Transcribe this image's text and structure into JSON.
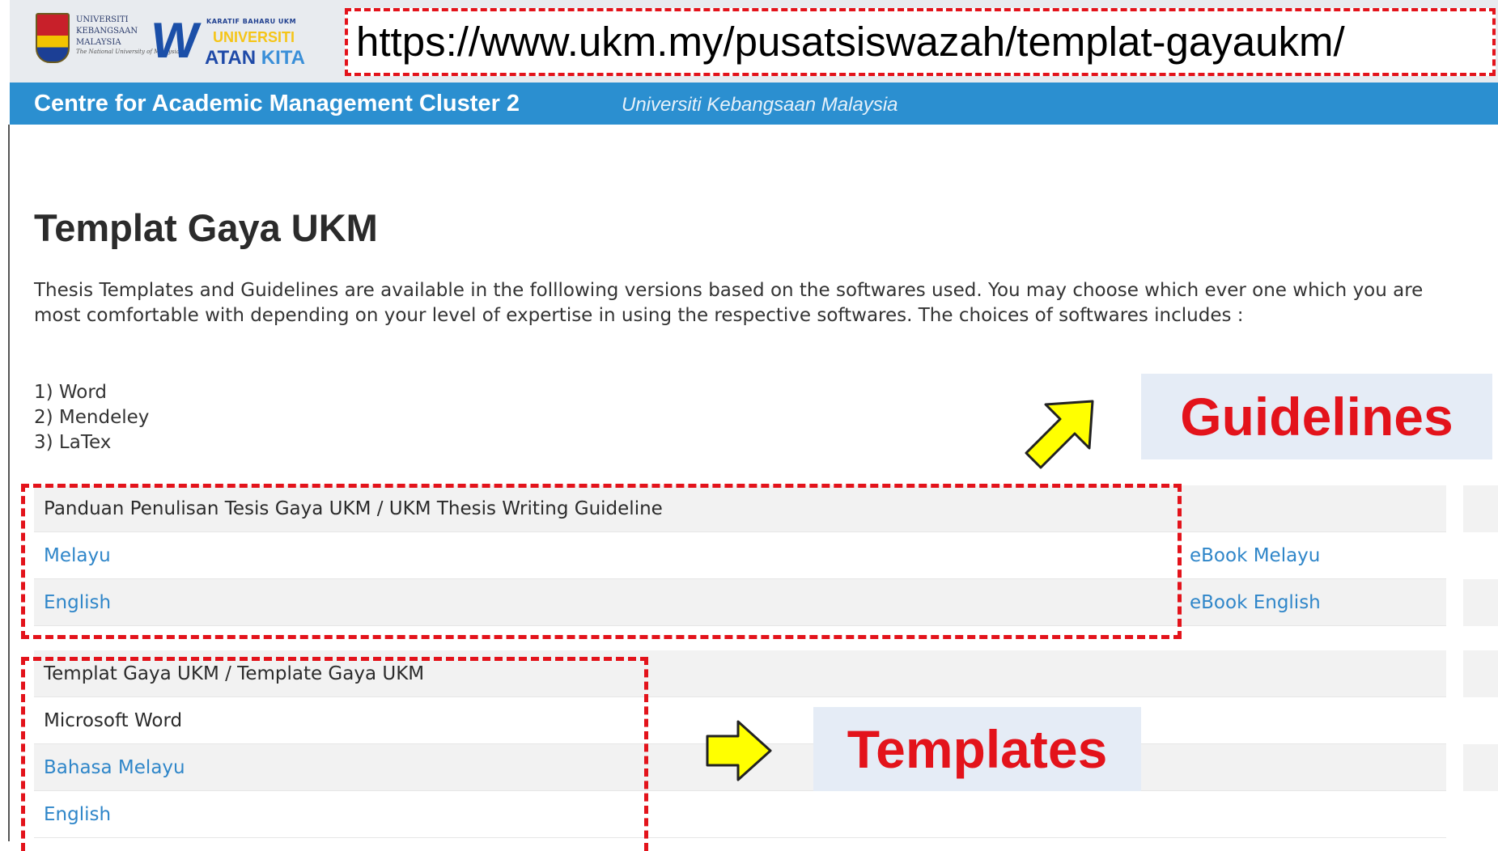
{
  "header": {
    "university_lines": [
      "UNIVERSITI",
      "KEBANGSAAN",
      "MALAYSIA",
      "The National University of Malaysia"
    ],
    "campaign": {
      "tagline": "KARATIF BAHARU UKM",
      "line1": "UNIVERSITI",
      "line2a": "ATAN",
      "line2b": "KITA"
    },
    "url": "https://www.ukm.my/pusatsiswazah/templat-gayaukm/",
    "site_title": "Centre for Academic Management Cluster 2",
    "site_subtitle": "Universiti Kebangsaan Malaysia"
  },
  "main": {
    "title": "Templat Gaya UKM",
    "intro": "Thesis Templates and Guidelines are available in the folllowing versions based on the softwares used. You may choose which ever one which you are most comfortable with depending on your level of expertise in using the respective softwares. The choices of softwares includes :",
    "software_list": [
      "1) Word",
      "2) Mendeley",
      "3) LaTex"
    ]
  },
  "guideline_table": {
    "heading": "Panduan Penulisan Tesis Gaya UKM / UKM Thesis Writing Guideline",
    "rows": [
      {
        "left": "Melayu",
        "right": "eBook Melayu"
      },
      {
        "left": "English",
        "right": "eBook English"
      }
    ]
  },
  "template_table": {
    "heading": "Templat Gaya UKM / Template Gaya UKM",
    "subheading": "Microsoft Word",
    "rows": [
      {
        "left": "Bahasa Melayu"
      },
      {
        "left": "English"
      }
    ]
  },
  "annotations": {
    "guidelines_label": "Guidelines",
    "templates_label": "Templates",
    "accent_color": "#e3131b",
    "arrow_color": "#ffff00"
  }
}
